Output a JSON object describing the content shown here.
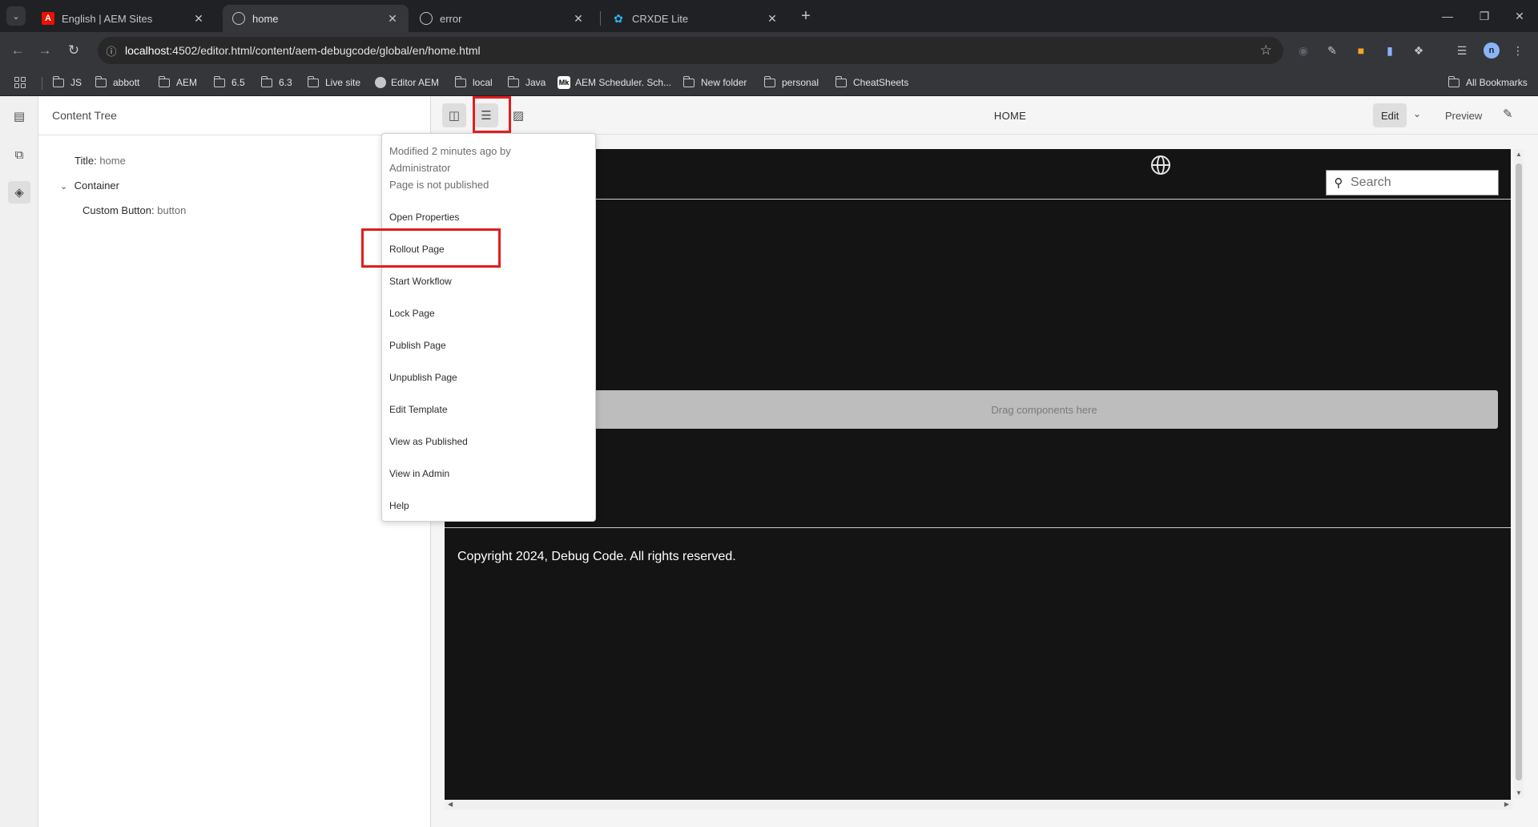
{
  "browser": {
    "tabs": [
      {
        "title": "English | AEM Sites",
        "icon": "adobe-icon"
      },
      {
        "title": "home",
        "icon": "globe-icon"
      },
      {
        "title": "error",
        "icon": "globe-icon"
      },
      {
        "title": "CRXDE Lite",
        "icon": "crx-icon"
      }
    ],
    "url_host": "localhost",
    "url_path": ":4502/editor.html/content/aem-debugcode/global/en/home.html",
    "profile_initial": "n",
    "bookmarks": [
      "JS",
      "abbott",
      "AEM",
      "6.5",
      "6.3",
      "Live site",
      "Editor AEM",
      "local",
      "Java",
      "AEM Scheduler. Sch...",
      "New folder",
      "personal",
      "CheatSheets"
    ],
    "all_bookmarks": "All Bookmarks",
    "colors": {
      "chrome_bg": "#202124",
      "active_tab": "#35363a",
      "adobe_red": "#eb1000",
      "crx_blue": "#29b6f6"
    }
  },
  "sidepanel": {
    "title": "Content Tree",
    "tree": {
      "title_label": "Title:",
      "title_value": "home",
      "container_label": "Container",
      "button_label": "Custom Button:",
      "button_value": "button"
    }
  },
  "editor": {
    "page_name": "HOME",
    "mode": "Edit",
    "preview": "Preview"
  },
  "page_info": {
    "modified": "Modified 2 minutes ago by",
    "author": "Administrator",
    "status": "Page is not published",
    "items": [
      "Open Properties",
      "Rollout Page",
      "Start Workflow",
      "Lock Page",
      "Publish Page",
      "Unpublish Page",
      "Edit Template",
      "View as Published",
      "View in Admin",
      "Help"
    ],
    "highlight_color": "#e01e1e"
  },
  "canvas": {
    "search_placeholder": "Search",
    "dropzone": "Drag components here",
    "copyright": "Copyright 2024, Debug Code. All rights reserved.",
    "background": "#141414"
  }
}
